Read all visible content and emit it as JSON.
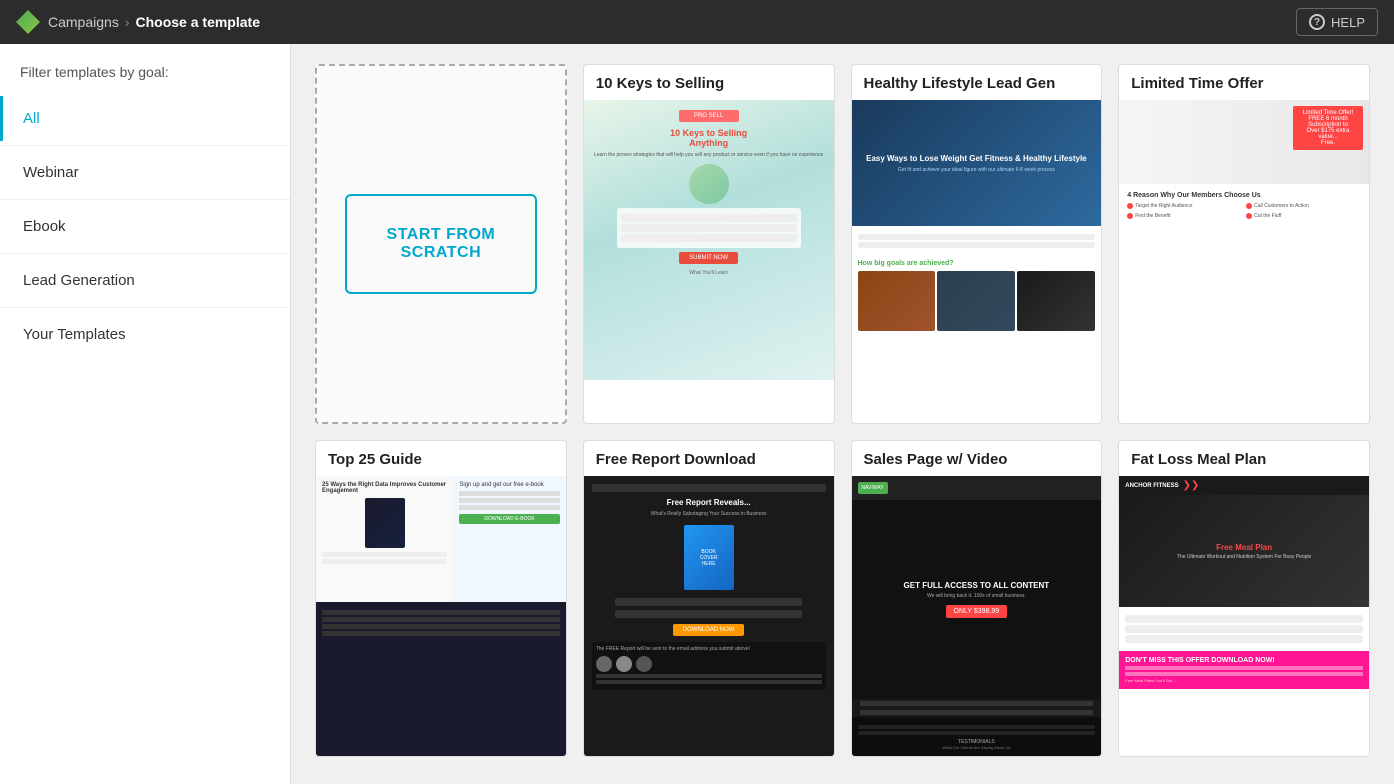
{
  "header": {
    "app_name": "Campaigns",
    "breadcrumb_arrow": "›",
    "page_title": "Choose a template",
    "help_label": "HELP",
    "help_icon": "?"
  },
  "sidebar": {
    "filter_label": "Filter templates by goal:",
    "items": [
      {
        "id": "all",
        "label": "All",
        "active": true
      },
      {
        "id": "webinar",
        "label": "Webinar",
        "active": false
      },
      {
        "id": "ebook",
        "label": "Ebook",
        "active": false
      },
      {
        "id": "lead-generation",
        "label": "Lead Generation",
        "active": false
      },
      {
        "id": "your-templates",
        "label": "Your Templates",
        "active": false
      }
    ]
  },
  "templates": {
    "scratch": {
      "line1": "START FROM",
      "line2": "SCRATCH"
    },
    "cards": [
      {
        "id": "10keys",
        "title": "10 Keys to Selling"
      },
      {
        "id": "healthy",
        "title": "Healthy Lifestyle Lead Gen"
      },
      {
        "id": "limited",
        "title": "Limited Time Offer"
      },
      {
        "id": "top25",
        "title": "Top 25 Guide"
      },
      {
        "id": "freereport",
        "title": "Free Report Download"
      },
      {
        "id": "salesvideo",
        "title": "Sales Page w/ Video"
      },
      {
        "id": "fatloss",
        "title": "Fat Loss Meal Plan"
      }
    ]
  }
}
